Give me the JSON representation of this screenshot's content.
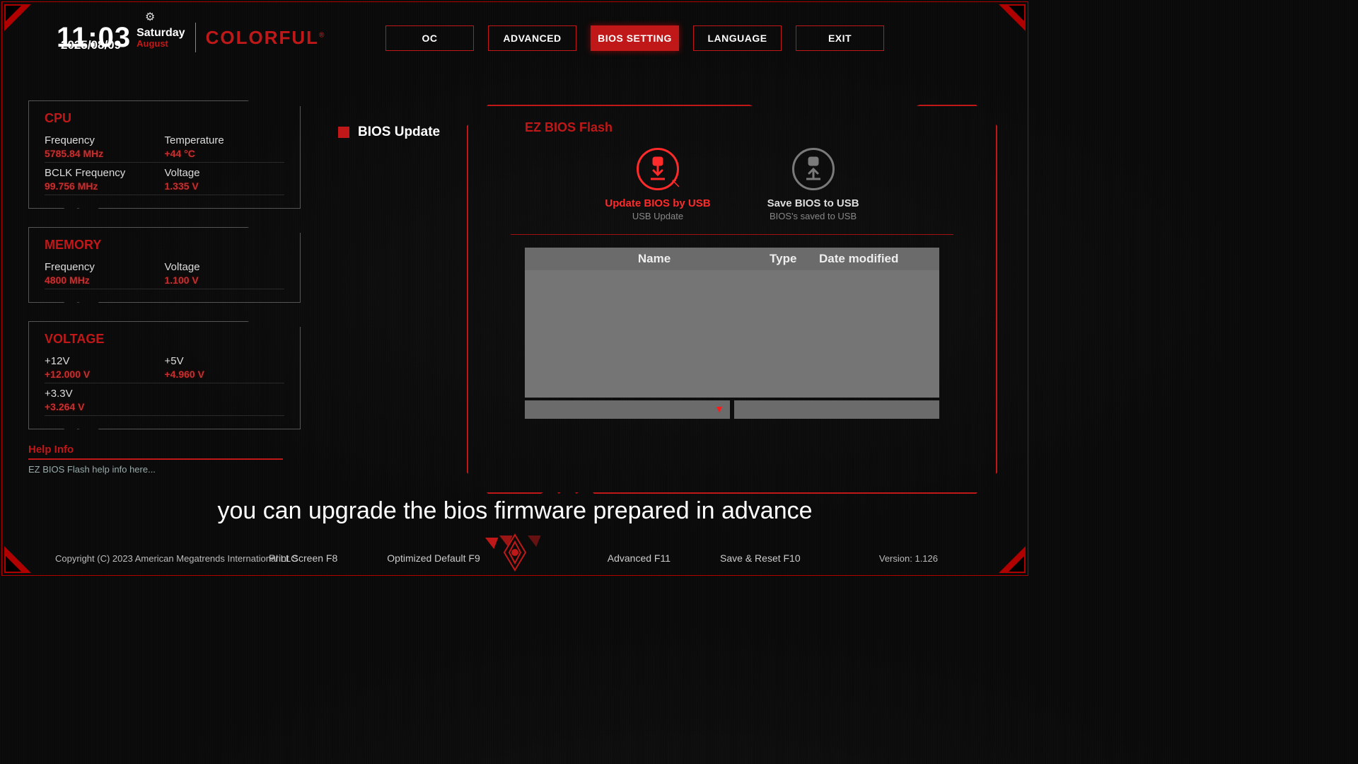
{
  "header": {
    "time": "11:03",
    "weekday": "Saturday",
    "month": "August",
    "date": "2025/08/09",
    "brand": "COLORFUL"
  },
  "nav": {
    "oc": "OC",
    "advanced": "ADVANCED",
    "bios_setting": "BIOS SETTING",
    "language": "LANGUAGE",
    "exit": "EXIT"
  },
  "cpu": {
    "title": "CPU",
    "freq_lbl": "Frequency",
    "freq_val": "5785.84 MHz",
    "temp_lbl": "Temperature",
    "temp_val": "+44 °C",
    "bclk_lbl": "BCLK Frequency",
    "bclk_val": "99.756 MHz",
    "volt_lbl": "Voltage",
    "volt_val": "1.335 V"
  },
  "memory": {
    "title": "MEMORY",
    "freq_lbl": "Frequency",
    "freq_val": "4800 MHz",
    "volt_lbl": "Voltage",
    "volt_val": "1.100 V"
  },
  "voltage": {
    "title": "VOLTAGE",
    "v12_lbl": "+12V",
    "v12_val": "+12.000 V",
    "v5_lbl": "+5V",
    "v5_val": "+4.960 V",
    "v33_lbl": "+3.3V",
    "v33_val": "+3.264 V"
  },
  "help": {
    "title": "Help Info",
    "text": "EZ BIOS Flash help info here..."
  },
  "section": {
    "label": "BIOS Update"
  },
  "main": {
    "title": "EZ BIOS Flash",
    "update_name": "Update BIOS by USB",
    "update_sub": "USB Update",
    "save_name": "Save BIOS to USB",
    "save_sub": "BIOS's saved to USB",
    "col_name": "Name",
    "col_type": "Type",
    "col_date": "Date modified"
  },
  "caption": "you can upgrade the bios firmware prepared in advance",
  "footer": {
    "copyright": "Copyright (C) 2023 American Megatrends International LLC",
    "f_print": "Print Screen F8",
    "f_default": "Optimized Default F9",
    "f_advanced": "Advanced F11",
    "f_save": "Save & Reset F10",
    "version": "Version: 1.126"
  }
}
